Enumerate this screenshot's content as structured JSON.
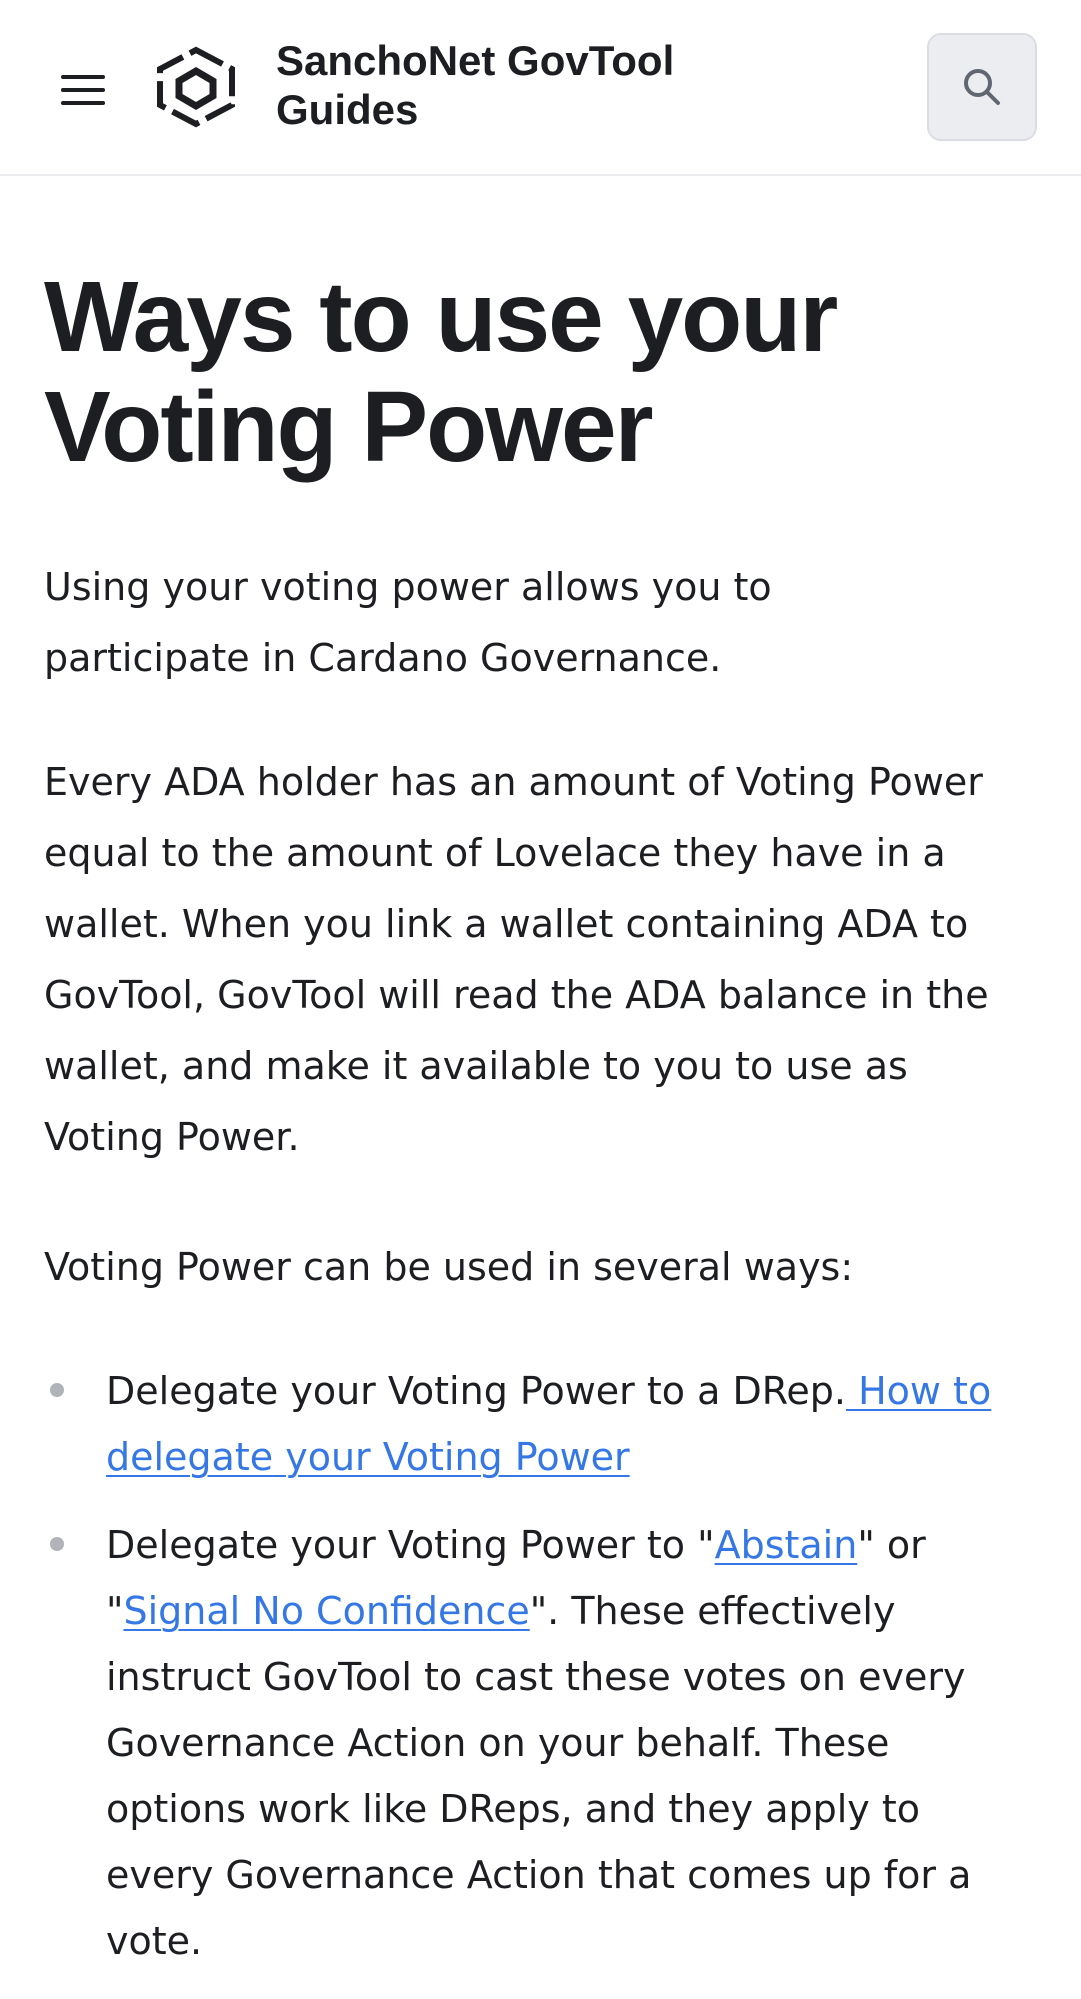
{
  "header": {
    "site_title": "SanchoNet GovTool Guides",
    "menu_icon": "hamburger-menu-icon",
    "logo_icon": "hexagon-logo-icon",
    "search_icon": "search-icon"
  },
  "page": {
    "title": "Ways to use your Voting Power",
    "paragraph_1": "Using your voting power allows you to participate in Cardano Governance.",
    "paragraph_2": "Every ADA holder has an amount of Voting Power equal to the amount of Lovelace they have in a wallet. When you link a wallet containing ADA to GovTool, GovTool will read the ADA balance in the wallet, and make it available to you to use as Voting Power.",
    "paragraph_3": "Voting Power can be used in several ways:",
    "list": [
      {
        "text_before": "Delegate your Voting Power to a DRep.",
        "link_text": " How to delegate your Voting Power"
      },
      {
        "text_before": "Delegate your Voting Power to \"",
        "link_1": "Abstain",
        "text_middle": "\" or \"",
        "link_2": "Signal No Confidence",
        "text_after": "\". These effectively instruct GovTool to cast these votes on every Governance Action on your behalf. These options work like DReps, and they apply to every Governance Action that comes up for a vote."
      }
    ]
  },
  "colors": {
    "text": "#1c1e21",
    "link": "#3578e5",
    "search_bg": "#ebedf0",
    "bullet": "#b0b3b8"
  }
}
